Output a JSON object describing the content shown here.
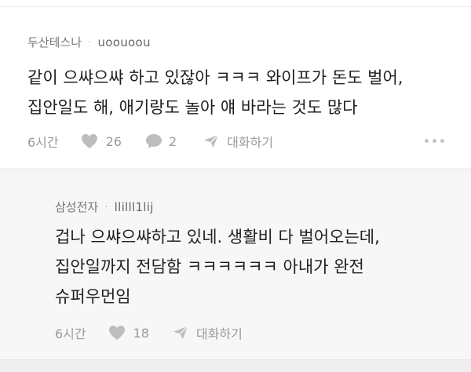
{
  "comments": [
    {
      "team": "두산테스나",
      "separator": "·",
      "nickname": "uoouoou",
      "lines": [
        "같이 으쌰으쌰 하고 있잖아 ㅋㅋㅋ 와이프가 돈도 벌어,",
        "집안일도 해, 애기랑도 놀아 얘 바라는 것도 많다"
      ],
      "time": "6시간",
      "likes": "26",
      "replies": "2",
      "reply_label": "대화하기",
      "like_icon": "heart-icon",
      "comment_icon": "speech-bubble-icon",
      "reply_icon": "send-icon",
      "more_icon": "more-dots-icon"
    },
    {
      "team": "삼성전자",
      "separator": "·",
      "nickname": "llilll1lij",
      "lines": [
        "겁나 으쌰으쌰하고 있네. 생활비 다 벌어오는데,",
        "집안일까지 전담함 ㅋㅋㅋㅋㅋㅋ 아내가 완전",
        "슈퍼우먼임"
      ],
      "time": "6시간",
      "likes": "18",
      "reply_label": "대화하기",
      "like_icon": "heart-icon",
      "reply_icon": "send-icon"
    }
  ],
  "colors": {
    "background": "#ffffff",
    "reply_background": "#f7f7f7",
    "text": "#1f1f1f",
    "meta": "#777777",
    "icon": "#bdbdbd"
  }
}
